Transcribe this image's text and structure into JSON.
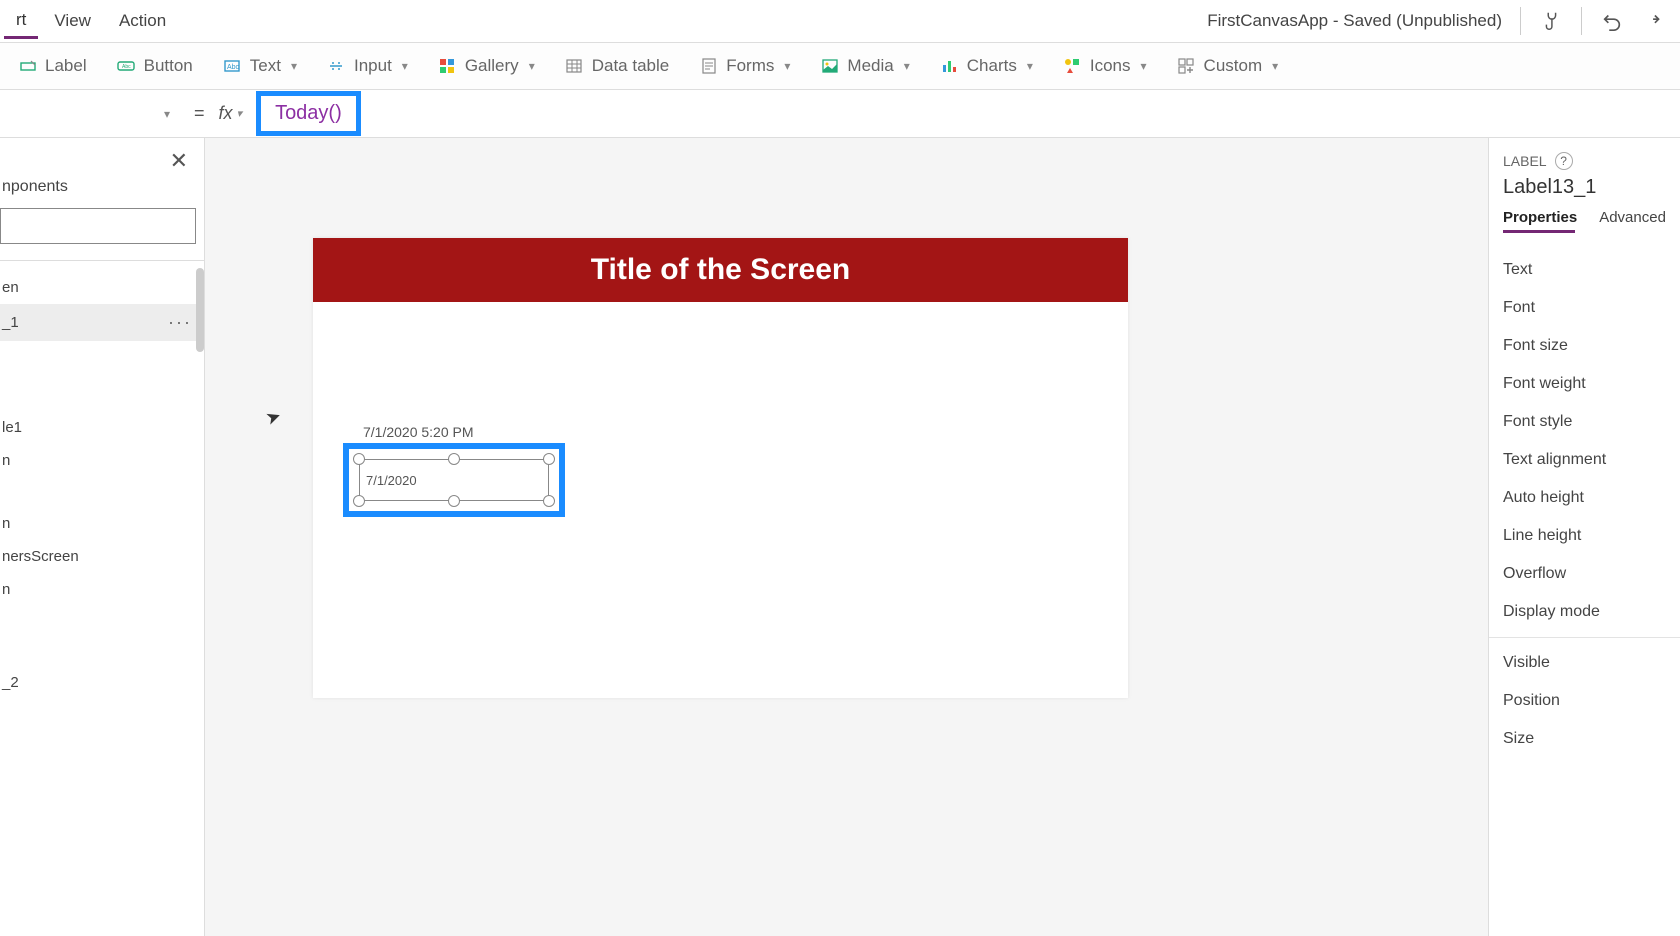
{
  "menubar": {
    "items": [
      "rt",
      "View",
      "Action"
    ],
    "app_title": "FirstCanvasApp - Saved (Unpublished)"
  },
  "ribbon": {
    "label": "Label",
    "button": "Button",
    "text": "Text",
    "input": "Input",
    "gallery": "Gallery",
    "datatable": "Data table",
    "forms": "Forms",
    "media": "Media",
    "charts": "Charts",
    "icons": "Icons",
    "custom": "Custom"
  },
  "formula": {
    "equals": "=",
    "fx": "fx",
    "expression": "Today()"
  },
  "leftpanel": {
    "tab": "nponents",
    "items": [
      "en",
      "_1",
      "le1",
      "n",
      "n",
      "nersScreen",
      "n",
      "_2"
    ],
    "selected_index": 1
  },
  "canvas": {
    "screen_title": "Title of the Screen",
    "static_label": "7/1/2020 5:20 PM",
    "selected_label_value": "7/1/2020"
  },
  "rightpanel": {
    "kind": "LABEL",
    "name": "Label13_1",
    "tabs": {
      "properties": "Properties",
      "advanced": "Advanced"
    },
    "props_group1": [
      "Text",
      "Font",
      "Font size",
      "Font weight",
      "Font style",
      "Text alignment",
      "Auto height",
      "Line height",
      "Overflow",
      "Display mode"
    ],
    "props_group2": [
      "Visible",
      "Position",
      "Size"
    ]
  }
}
